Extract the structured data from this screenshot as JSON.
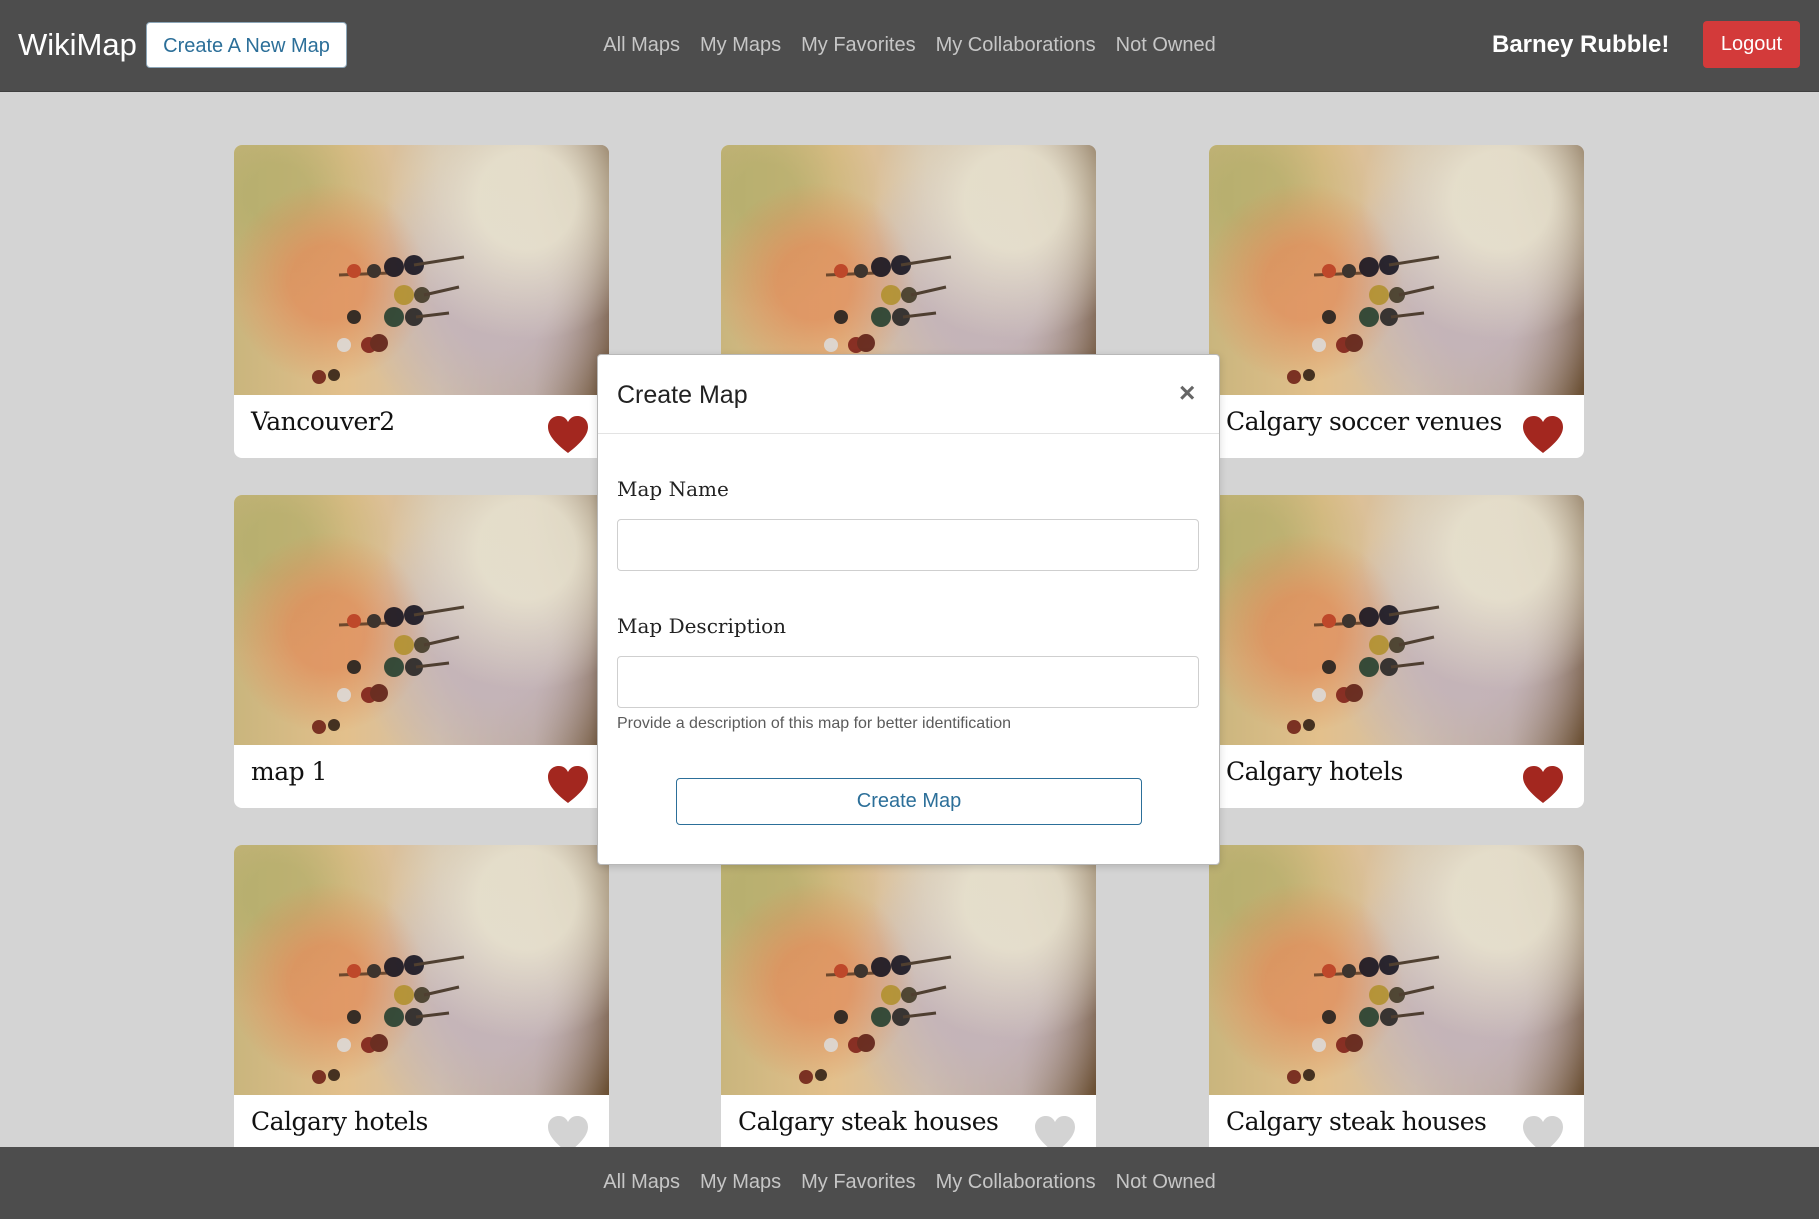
{
  "navbar": {
    "brand": "WikiMap",
    "create_button": "Create A New Map",
    "links": [
      "All Maps",
      "My Maps",
      "My Favorites",
      "My Collaborations",
      "Not Owned"
    ],
    "user": "Barney Rubble!",
    "logout": "Logout"
  },
  "maps": [
    {
      "title": "Vancouver2",
      "favorited": true
    },
    {
      "title": "",
      "favorited": null
    },
    {
      "title": "Calgary soccer venues",
      "favorited": true
    },
    {
      "title": "map 1",
      "favorited": true
    },
    {
      "title": "",
      "favorited": null
    },
    {
      "title": "Calgary hotels",
      "favorited": true
    },
    {
      "title": "Calgary hotels",
      "favorited": false
    },
    {
      "title": "Calgary steak houses",
      "favorited": false
    },
    {
      "title": "Calgary steak houses",
      "favorited": false
    }
  ],
  "modal": {
    "title": "Create Map",
    "close": "×",
    "name_label": "Map Name",
    "name_value": "",
    "description_label": "Map Description",
    "description_value": "",
    "help": "Provide a description of this map for better identification",
    "submit": "Create Map"
  },
  "footer": {
    "links": [
      "All Maps",
      "My Maps",
      "My Favorites",
      "My Collaborations",
      "Not Owned"
    ]
  },
  "colors": {
    "heart_on": "#a3271f",
    "heart_off": "#d3d3d3",
    "accent": "#2c6f99",
    "logout": "#d33a3a"
  }
}
